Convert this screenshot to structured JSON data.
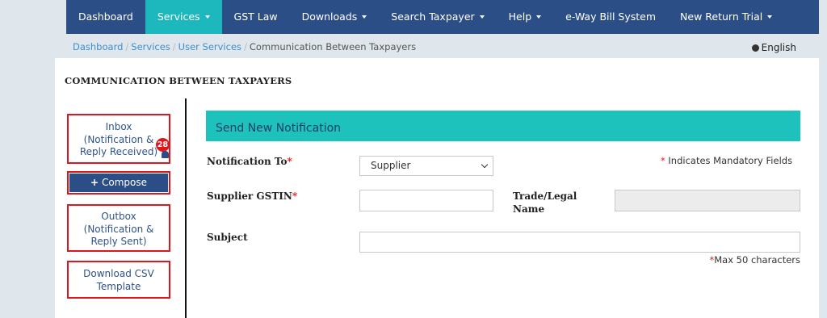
{
  "nav": {
    "items": [
      {
        "label": "Dashboard",
        "dropdown": false
      },
      {
        "label": "Services",
        "dropdown": true,
        "active": true
      },
      {
        "label": "GST Law",
        "dropdown": false
      },
      {
        "label": "Downloads",
        "dropdown": true
      },
      {
        "label": "Search Taxpayer",
        "dropdown": true
      },
      {
        "label": "Help",
        "dropdown": true
      },
      {
        "label": "e-Way Bill System",
        "dropdown": false
      },
      {
        "label": "New Return Trial",
        "dropdown": true
      }
    ]
  },
  "breadcrumb": {
    "links": [
      "Dashboard",
      "Services",
      "User Services"
    ],
    "separator": "/",
    "current": "Communication Between Taxpayers"
  },
  "language": "English",
  "page_title": "COMMUNICATION BETWEEN TAXPAYERS",
  "sidebar": {
    "inbox": {
      "line1": "Inbox",
      "line2": "(Notification &",
      "line3": "Reply Received)",
      "badge": "28"
    },
    "compose": {
      "icon": "+",
      "label": "Compose"
    },
    "outbox": {
      "line1": "Outbox",
      "line2": "(Notification &",
      "line3": "Reply Sent)"
    },
    "csv": {
      "line1": "Download CSV",
      "line2": "Template"
    }
  },
  "form": {
    "header": "Send New Notification",
    "notification_to": {
      "label": "Notification To",
      "required": "*",
      "value": "Supplier"
    },
    "mandatory_note": {
      "star": "*",
      "text": " Indicates Mandatory Fields"
    },
    "supplier_gstin": {
      "label": "Supplier GSTIN",
      "required": "*",
      "value": ""
    },
    "trade_name": {
      "label_line1": "Trade/Legal",
      "label_line2": "Name",
      "value": ""
    },
    "subject": {
      "label": "Subject",
      "value": ""
    },
    "max_note": {
      "star": "*",
      "text": "Max 50 characters"
    }
  },
  "colors": {
    "nav_bg": "#2c4e86",
    "nav_active": "#1cb8bd",
    "form_header_bg": "#1cc2bb",
    "highlight_border": "#e0161c",
    "link": "#3d8ecf"
  }
}
